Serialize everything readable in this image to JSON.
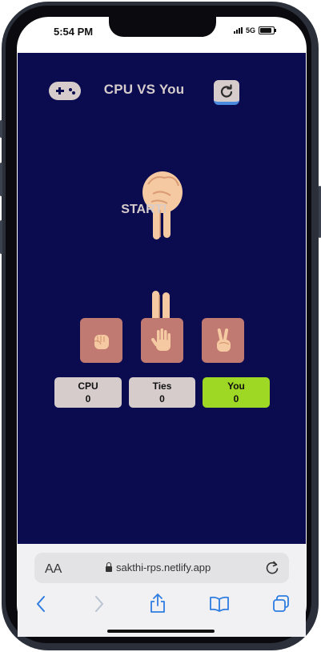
{
  "status_bar": {
    "time": "5:54 PM",
    "network": "5G"
  },
  "app": {
    "title": "CPU VS You",
    "status_message": "START!",
    "choices": [
      {
        "name": "rock"
      },
      {
        "name": "paper"
      },
      {
        "name": "scissors"
      }
    ],
    "scores": [
      {
        "label": "CPU",
        "value": "0"
      },
      {
        "label": "Ties",
        "value": "0"
      },
      {
        "label": "You",
        "value": "0"
      }
    ],
    "colors": {
      "background": "#0b0c4f",
      "you_score": "#9fd824",
      "choice_tile": "#c17a72"
    }
  },
  "browser": {
    "text_size_label": "AA",
    "url": "sakthi-rps.netlify.app"
  }
}
